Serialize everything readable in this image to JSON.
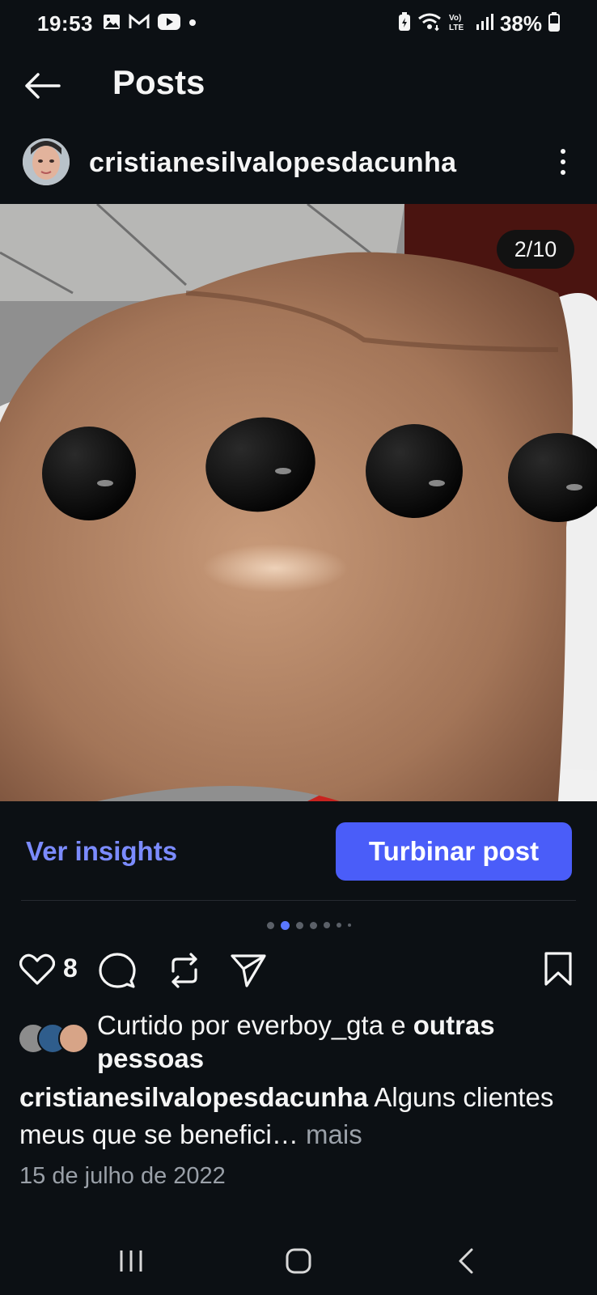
{
  "status_bar": {
    "time": "19:53",
    "battery": "38%",
    "left_icons": [
      "gallery-icon",
      "gmail-icon",
      "youtube-icon",
      "dot-icon"
    ],
    "right_icons": [
      "battery-saver-icon",
      "wifi-icon",
      "volte-icon",
      "signal-icon",
      "battery-icon"
    ]
  },
  "header": {
    "title": "Posts"
  },
  "post": {
    "username": "cristianesilvalopesdacunha",
    "counter": "2/10",
    "insights_label": "Ver insights",
    "boost_label": "Turbinar post",
    "like_count": "8",
    "carousel": {
      "count": 7,
      "active_index": 1
    },
    "liked_by_prefix": "Curtido por ",
    "liked_by_user": "everboy_gta",
    "liked_by_middle": " e ",
    "liked_by_others": "outras pessoas",
    "caption_user": "cristianesilvalopesdacunha",
    "caption_text": " Alguns clientes meus que se benefici… ",
    "caption_more": "mais",
    "date": "15 de julho de 2022"
  },
  "colors": {
    "background": "#0c1014",
    "accent": "#4a5df9",
    "link": "#7b8bff",
    "secondary_text": "#9aa0a8"
  }
}
